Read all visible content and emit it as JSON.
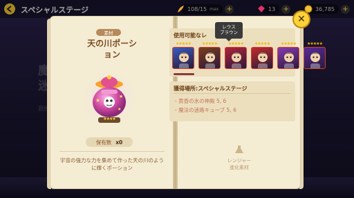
{
  "topbar": {
    "title": "スペシャルステージ",
    "stamina": "108/15",
    "stamina_max_label": "max",
    "gems": "13",
    "coins": "36,785"
  },
  "background": {
    "title_line1": "魔",
    "title_line2": "迷",
    "subtext": "我他"
  },
  "left_page": {
    "material_tag": "素材",
    "item_name_line1": "天の川ポーシ",
    "item_name_line2": "ョン",
    "item_icon": "milky-way-potion",
    "item_rarity_stars": "★★★★",
    "owned_label": "保有数",
    "owned_count": "x0",
    "description": "宇宙の強力な力を集めて作った天の川のように輝くポーション"
  },
  "right_page": {
    "units_title": "使用可能なレ",
    "tooltip_line1": "レウス",
    "tooltip_line2": "ブラウン",
    "units": [
      {
        "name": "unit-1",
        "stars": "★★★★★",
        "color": "#3a5bbf"
      },
      {
        "name": "unit-2",
        "stars": "★★★★★",
        "color": "#7a3d1e"
      },
      {
        "name": "unit-3",
        "stars": "★★★★★",
        "color": "#b2233a"
      },
      {
        "name": "unit-4",
        "stars": "★★★★★",
        "color": "#c42a2a"
      },
      {
        "name": "unit-5",
        "stars": "★★★★★",
        "color": "#8a3ab0"
      },
      {
        "name": "unit-6",
        "stars": "★★★★★",
        "color": "#5a2a9a"
      }
    ],
    "source_title": "獲得場所:スペシャルステージ",
    "sources": [
      "- 黄昏の氷の神殿 5, 6",
      "- 魔法の迷路キューブ 5, 6"
    ],
    "ranger_label": "レンジャー",
    "ranger_sublabel": "進化素材"
  },
  "colors": {
    "accent": "#ffd23a",
    "page": "#f5ecd4",
    "title_brown": "#7a4a1e"
  }
}
